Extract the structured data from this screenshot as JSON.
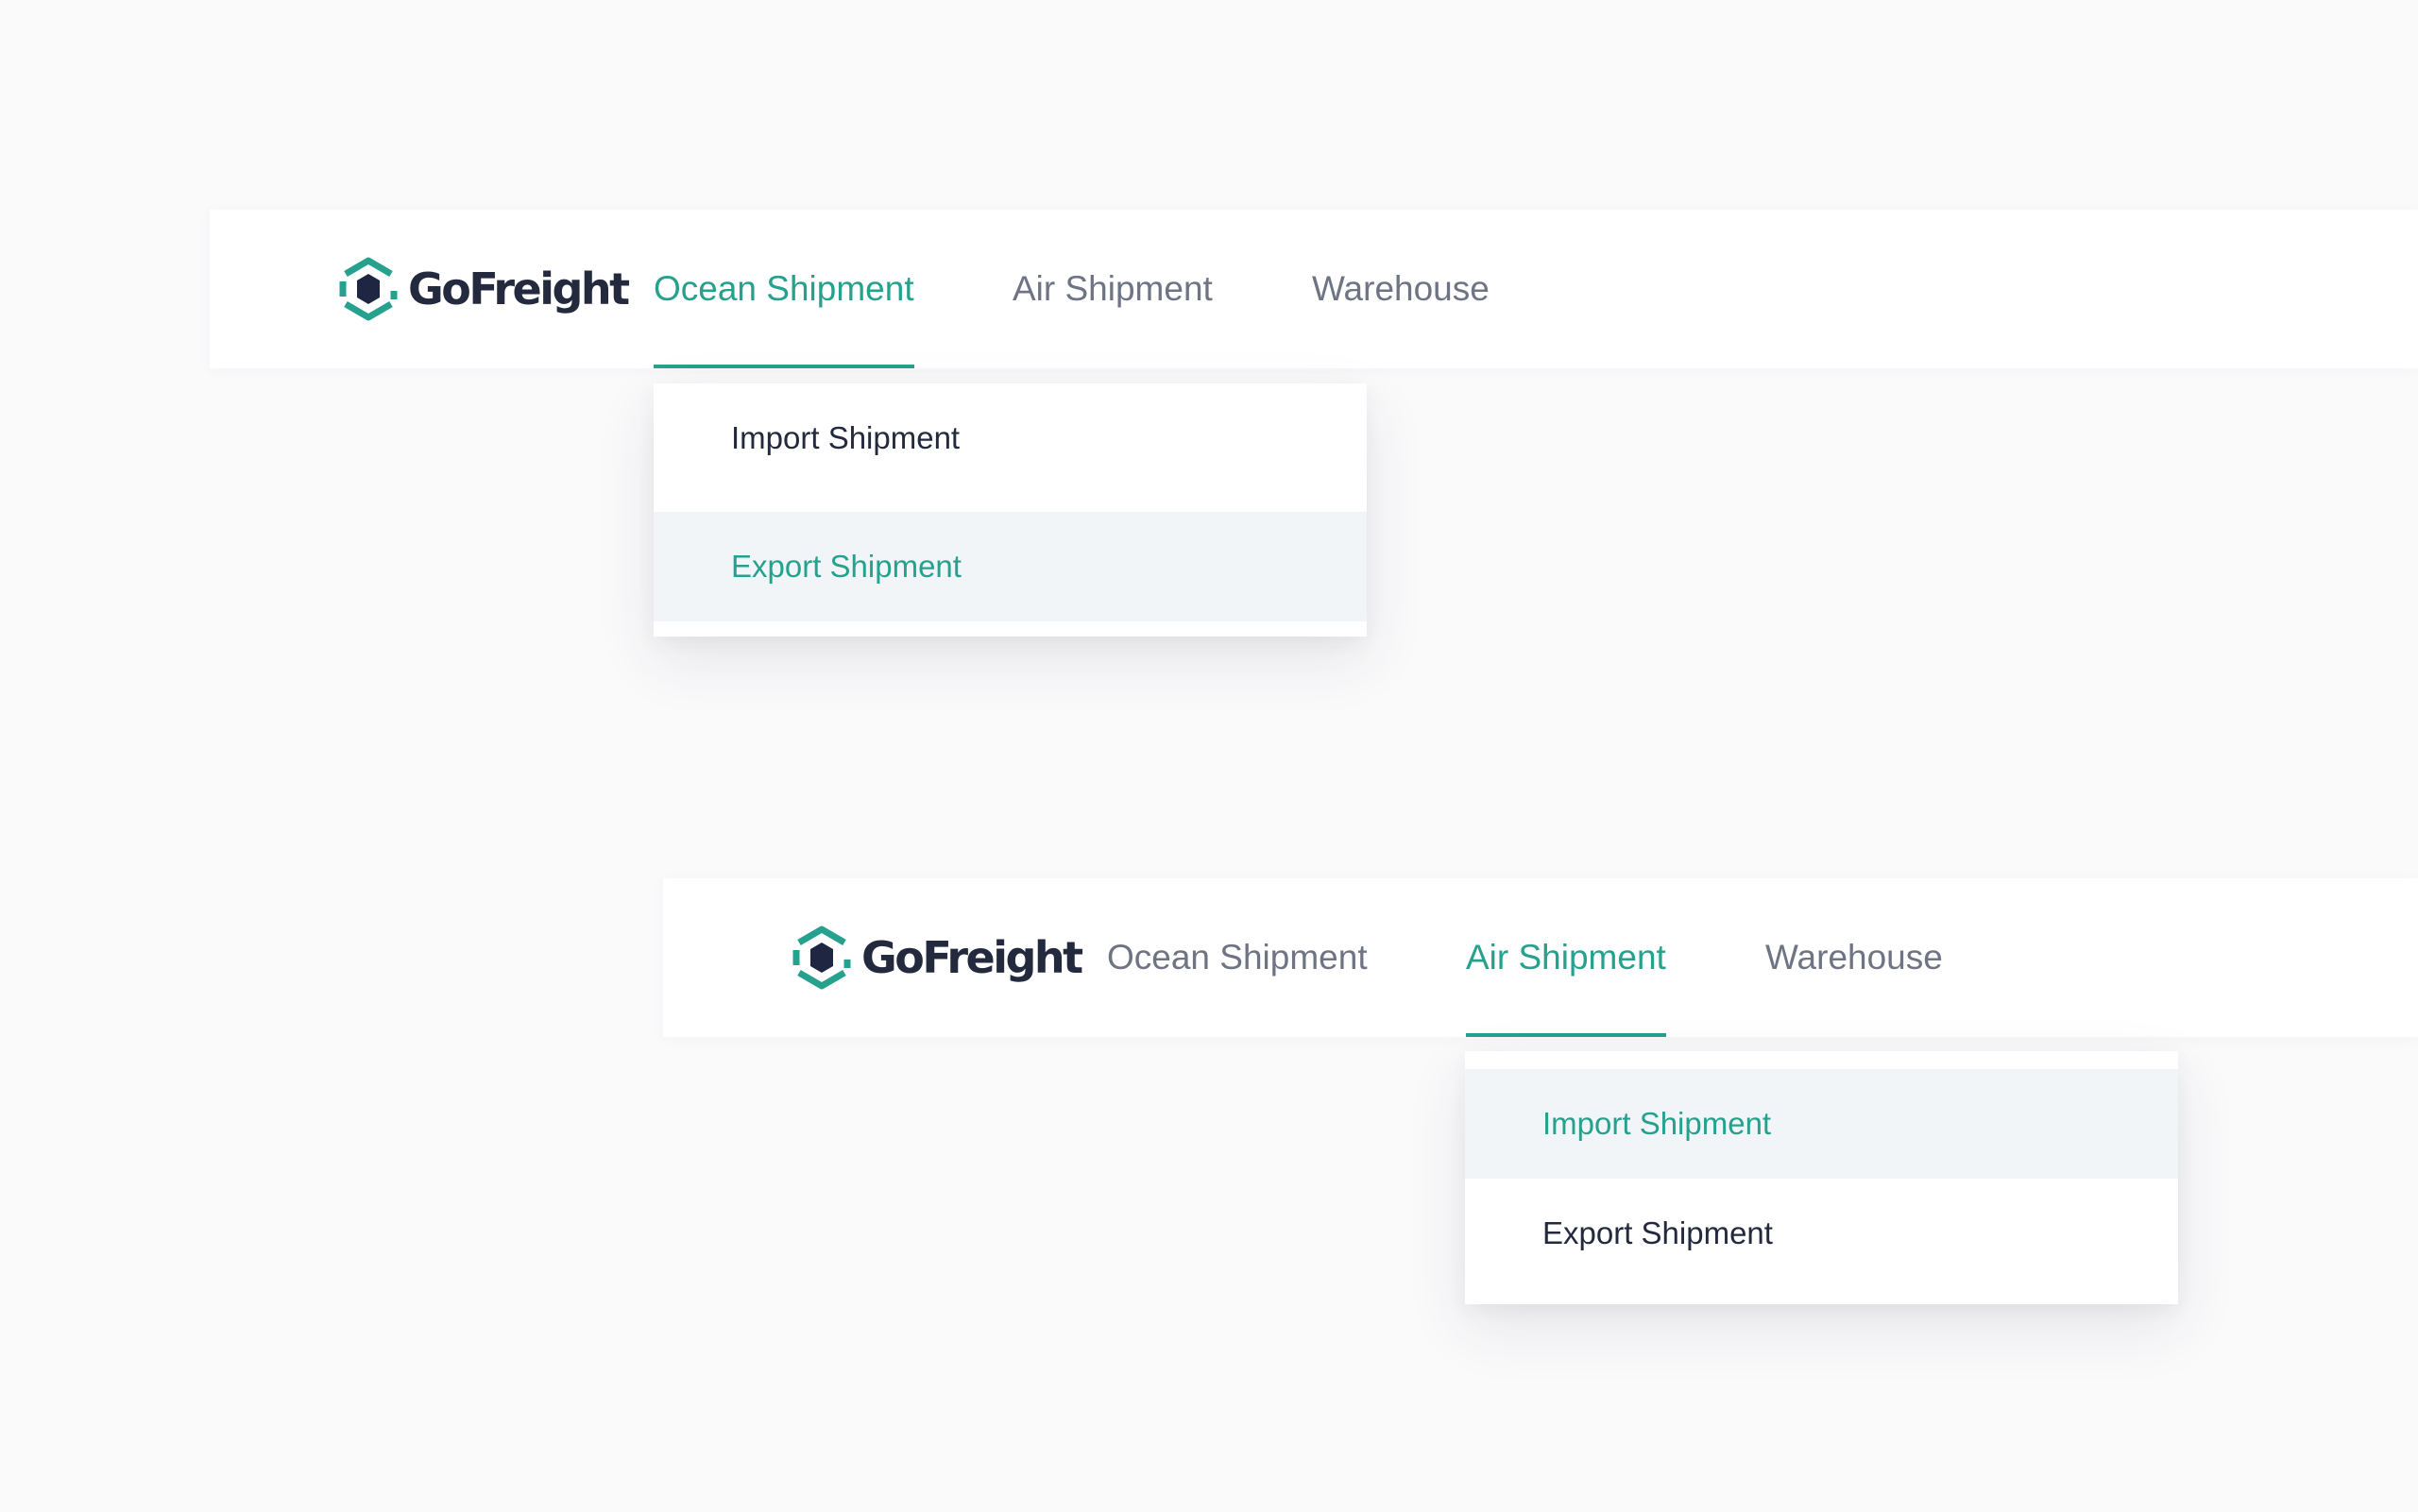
{
  "brand": {
    "name": "GoFreight",
    "primary_color": "#26a18e",
    "dark_color": "#232a3e"
  },
  "navbars": [
    {
      "items": [
        {
          "label": "Ocean Shipment",
          "active": true
        },
        {
          "label": "Air Shipment",
          "active": false
        },
        {
          "label": "Warehouse",
          "active": false
        }
      ],
      "dropdown": [
        {
          "label": "Import Shipment",
          "highlighted": false
        },
        {
          "label": "Export Shipment",
          "highlighted": true
        }
      ]
    },
    {
      "items": [
        {
          "label": "Ocean Shipment",
          "active": false
        },
        {
          "label": "Air Shipment",
          "active": true
        },
        {
          "label": "Warehouse",
          "active": false
        }
      ],
      "dropdown": [
        {
          "label": "Import Shipment",
          "highlighted": true
        },
        {
          "label": "Export Shipment",
          "highlighted": false
        }
      ]
    }
  ]
}
